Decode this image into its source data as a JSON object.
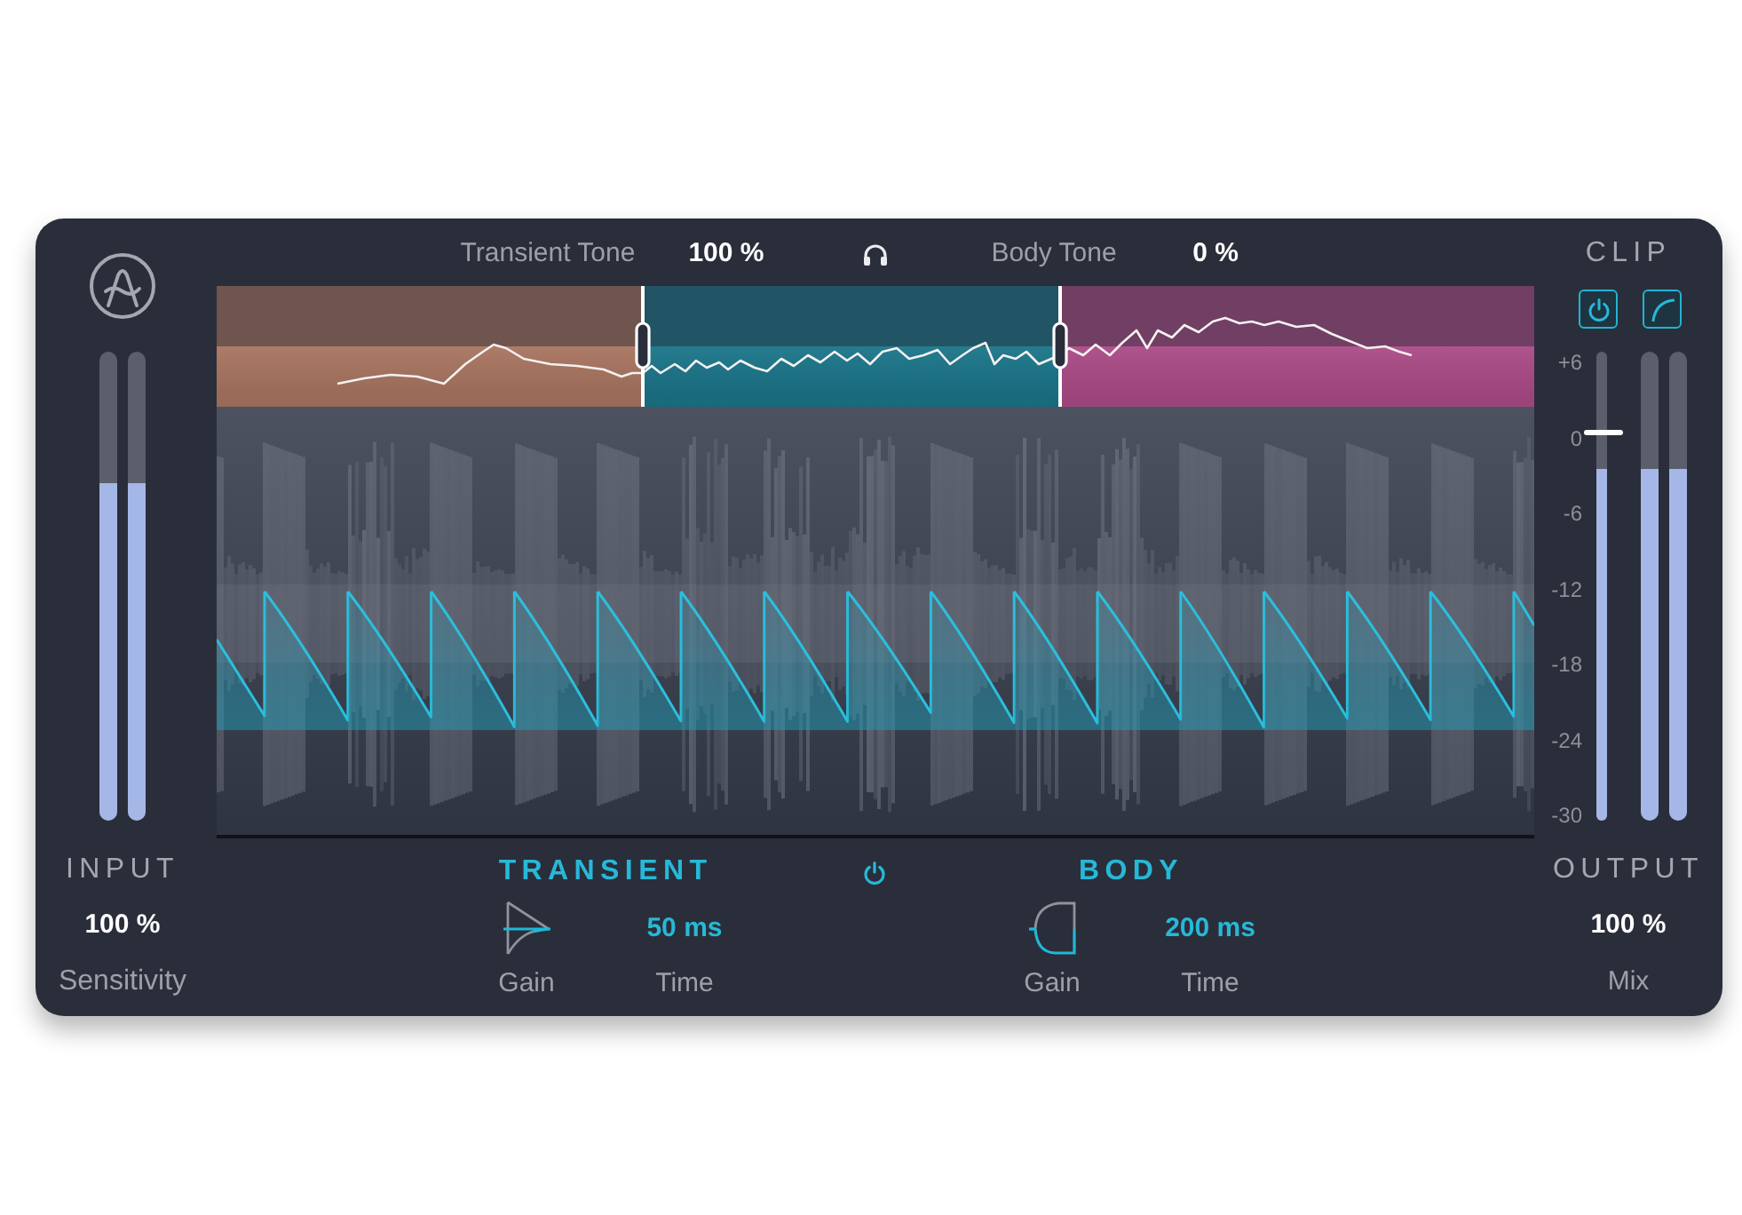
{
  "tone_bar": {
    "transient_label": "Transient Tone",
    "transient_value": "100 %",
    "body_label": "Body Tone",
    "body_value": "0 %"
  },
  "bands": [
    {
      "color": "#a87560"
    },
    {
      "color": "#1b7589"
    },
    {
      "color": "#ab4b87"
    }
  ],
  "input": {
    "title": "INPUT",
    "meters": [
      {
        "level": 0.72
      },
      {
        "level": 0.72
      }
    ],
    "value": "100 %",
    "label": "Sensitivity"
  },
  "sections": [
    {
      "kind": "transient",
      "title": "TRANSIENT",
      "time_value": "50 ms",
      "gain_label": "Gain",
      "time_label": "Time"
    },
    {
      "kind": "body",
      "title": "BODY",
      "time_value": "200 ms",
      "gain_label": "Gain",
      "time_label": "Time"
    }
  ],
  "output": {
    "clip_title": "CLIP",
    "scale": [
      "+6",
      "0",
      "-6",
      "-12",
      "-18",
      "-24",
      "-30"
    ],
    "meters": [
      {
        "kind": "clip",
        "level": 0.75
      },
      {
        "kind": "channel",
        "level": 0.75
      },
      {
        "kind": "channel",
        "level": 0.75
      }
    ],
    "title": "OUTPUT",
    "value": "100 %",
    "label": "Mix"
  }
}
